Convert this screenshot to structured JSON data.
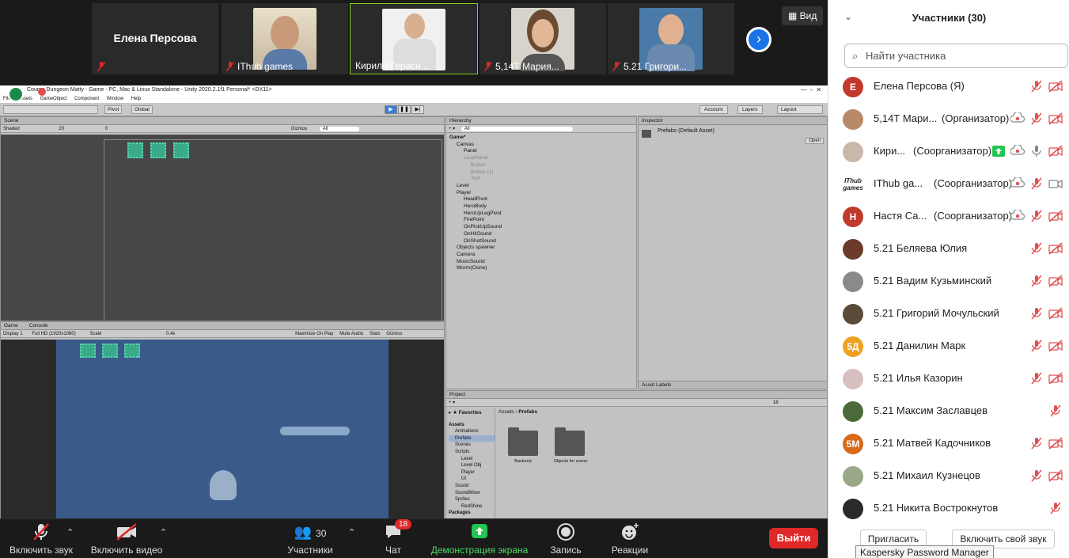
{
  "tiles": [
    {
      "name": "Елена Персова",
      "type": "text"
    },
    {
      "name": "IThub games",
      "type": "video"
    },
    {
      "name": "Кирилл Гераси...",
      "type": "video",
      "active": true
    },
    {
      "name": "5,14Т Мария...",
      "type": "video"
    },
    {
      "name": "5.21 Григори...",
      "type": "video"
    }
  ],
  "view_label": "Вид",
  "unity": {
    "title": "Course Dungeon Matty - Game - PC, Mac & Linux Standalone - Unity 2020.2.1f1 Personal* <DX11>",
    "menu": [
      "File",
      "Assets",
      "GameObject",
      "Component",
      "Window",
      "Help"
    ],
    "tool": {
      "pivot": "Pivot",
      "global": "Global",
      "account": "Account",
      "layers": "Layers",
      "layout": "Layout"
    },
    "scene": {
      "tab": "Scene",
      "shaded": "Shaded",
      "twod": "20",
      "gizmos": "Gizmos",
      "search": "All",
      "fx": "0"
    },
    "game": {
      "tab_game": "Game",
      "tab_console": "Console",
      "display": "Display 1",
      "res": "Full HD (1920x1080)",
      "scale": "Scale",
      "scale_val": "0.4x",
      "maximize": "Maximize On Play",
      "mute": "Mute Audio",
      "stats": "Stats",
      "gizmos": "Gizmos"
    },
    "hierarchy": {
      "tab": "Hierarchy",
      "search": "All",
      "items": [
        {
          "t": "Game*",
          "d": 0
        },
        {
          "t": "Canvas",
          "d": 1
        },
        {
          "t": "Panel",
          "d": 2
        },
        {
          "t": "LosePanel",
          "d": 2,
          "dim": true
        },
        {
          "t": "Button",
          "d": 3,
          "dim": true
        },
        {
          "t": "Button (1)",
          "d": 3,
          "dim": true
        },
        {
          "t": "Text",
          "d": 3,
          "dim": true
        },
        {
          "t": "Level",
          "d": 1
        },
        {
          "t": "Player",
          "d": 1
        },
        {
          "t": "HeadPivot",
          "d": 2
        },
        {
          "t": "HeroBody",
          "d": 2
        },
        {
          "t": "HeroUpLegPivot",
          "d": 2
        },
        {
          "t": "FirePoint",
          "d": 2
        },
        {
          "t": "OnPickUpSound",
          "d": 2
        },
        {
          "t": "OnHitSound",
          "d": 2
        },
        {
          "t": "OnShotSound",
          "d": 2
        },
        {
          "t": "Objects spawner",
          "d": 1
        },
        {
          "t": "Camera",
          "d": 1
        },
        {
          "t": "MusicSound",
          "d": 1
        },
        {
          "t": "Worm(Clone)",
          "d": 1
        }
      ]
    },
    "inspector": {
      "tab": "Inspector",
      "asset": "Prefabs (Default Asset)",
      "open": "Open",
      "labels": "Asset Labels"
    },
    "project": {
      "tab": "Project",
      "favorites": "Favorites",
      "crumb": "Assets",
      "crumb2": "Prefabs",
      "count": "18",
      "tree": [
        {
          "t": "Assets",
          "d": 0
        },
        {
          "t": "Animations",
          "d": 1
        },
        {
          "t": "Prefabs",
          "d": 1,
          "sel": true
        },
        {
          "t": "Scenes",
          "d": 1
        },
        {
          "t": "Scripts",
          "d": 1
        },
        {
          "t": "Level",
          "d": 2
        },
        {
          "t": "Level Obj",
          "d": 2
        },
        {
          "t": "Player",
          "d": 2
        },
        {
          "t": "UI",
          "d": 2
        },
        {
          "t": "Sound",
          "d": 1
        },
        {
          "t": "SoundMixer",
          "d": 1
        },
        {
          "t": "Sprites",
          "d": 1
        },
        {
          "t": "RedShine",
          "d": 2
        },
        {
          "t": "Packages",
          "d": 0
        }
      ],
      "folders": [
        "Backend",
        "Objects for scene"
      ]
    }
  },
  "toolbar": {
    "audio": "Включить звук",
    "video": "Включить видео",
    "participants": "Участники",
    "participants_count": "30",
    "chat": "Чат",
    "chat_badge": "18",
    "share": "Демонстрация экрана",
    "record": "Запись",
    "reactions": "Реакции",
    "leave": "Выйти"
  },
  "panel": {
    "title": "Участники (30)",
    "search_placeholder": "Найти участника",
    "participants": [
      {
        "name": "Елена Персова (Я)",
        "role": "",
        "initials": "Е",
        "color": "#c0392b",
        "icons": [
          "mic-off",
          "video-off"
        ]
      },
      {
        "name": "5,14Т Мари...",
        "role": "(Организатор)",
        "initials": "",
        "color": "#b88a6a",
        "icons": [
          "rec",
          "mic-off",
          "video-off"
        ]
      },
      {
        "name": "Кири...",
        "role": "(Соорганизатор)",
        "initials": "",
        "color": "#c9b8a8",
        "icons": [
          "share",
          "rec",
          "mic",
          "video-off"
        ]
      },
      {
        "name": "IThub ga...",
        "role": "(Соорганизатор)",
        "initials": "IThub games",
        "color": "#ffffff",
        "icons": [
          "rec",
          "mic-off",
          "video"
        ]
      },
      {
        "name": "Настя Са...",
        "role": "(Соорганизатор)",
        "initials": "Н",
        "color": "#c0392b",
        "icons": [
          "rec",
          "mic-off",
          "video-off"
        ]
      },
      {
        "name": "5.21 Беляева Юлия",
        "role": "",
        "initials": "",
        "color": "#6b3a2a",
        "icons": [
          "mic-off",
          "video-off"
        ]
      },
      {
        "name": "5.21 Вадим Кузьминский",
        "role": "",
        "initials": "",
        "color": "#8a8a8a",
        "icons": [
          "mic-off",
          "video-off"
        ]
      },
      {
        "name": "5.21 Григорий Мочульский",
        "role": "",
        "initials": "",
        "color": "#5a4a3a",
        "icons": [
          "mic-off",
          "video-off"
        ]
      },
      {
        "name": "5.21 Данилин Марк",
        "role": "",
        "initials": "5Д",
        "color": "#f0a020",
        "icons": [
          "mic-off",
          "video-off"
        ]
      },
      {
        "name": "5.21 Илья Казорин",
        "role": "",
        "initials": "",
        "color": "#d8c0c0",
        "icons": [
          "mic-off",
          "video-off"
        ]
      },
      {
        "name": "5.21 Максим  Заславцев",
        "role": "",
        "initials": "",
        "color": "#4a6a3a",
        "icons": [
          "mic-off"
        ]
      },
      {
        "name": "5.21 Матвей Кадочников",
        "role": "",
        "initials": "5М",
        "color": "#d86a1a",
        "icons": [
          "mic-off",
          "video-off"
        ]
      },
      {
        "name": "5.21 Михаил Кузнецов",
        "role": "",
        "initials": "",
        "color": "#9aa88a",
        "icons": [
          "mic-off",
          "video-off"
        ]
      },
      {
        "name": "5.21 Никита Вострокнутов",
        "role": "",
        "initials": "",
        "color": "#2a2a2a",
        "icons": [
          "mic-off"
        ]
      }
    ],
    "invite": "Пригласить",
    "unmute_me": "Включить свой звук"
  },
  "tooltip": "Kaspersky Password Manager"
}
